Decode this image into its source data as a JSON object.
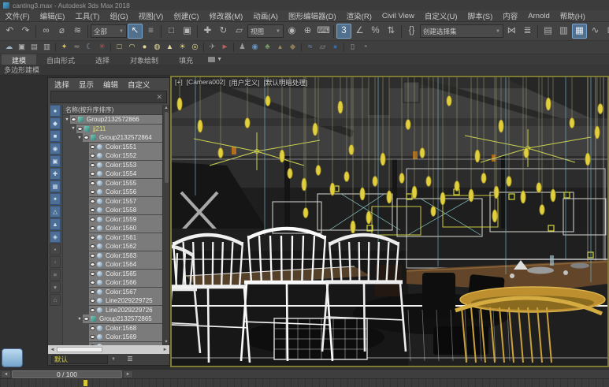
{
  "window": {
    "title": "canting3.max - Autodesk 3ds Max 2018"
  },
  "menu": {
    "items": [
      {
        "name": "menu-file",
        "label": "文件(F)"
      },
      {
        "name": "menu-edit",
        "label": "编辑(E)"
      },
      {
        "name": "menu-tools",
        "label": "工具(T)"
      },
      {
        "name": "menu-group",
        "label": "组(G)"
      },
      {
        "name": "menu-views",
        "label": "视图(V)"
      },
      {
        "name": "menu-create",
        "label": "创建(C)"
      },
      {
        "name": "menu-modifiers",
        "label": "修改器(M)"
      },
      {
        "name": "menu-animation",
        "label": "动画(A)"
      },
      {
        "name": "menu-graph-editors",
        "label": "图形编辑器(D)"
      },
      {
        "name": "menu-rendering",
        "label": "渲染(R)"
      },
      {
        "name": "menu-civil-view",
        "label": "Civil View"
      },
      {
        "name": "menu-customize",
        "label": "自定义(U)"
      },
      {
        "name": "menu-scripting",
        "label": "脚本(S)"
      },
      {
        "name": "menu-content",
        "label": "内容"
      },
      {
        "name": "menu-arnold",
        "label": "Arnold"
      },
      {
        "name": "menu-help",
        "label": "帮助(H)"
      }
    ]
  },
  "toolbar1": {
    "filter_value": "全部",
    "coord_value": "视图",
    "set_value": "创建选择集",
    "icons1": [
      {
        "name": "undo-icon",
        "glyph": "↶"
      },
      {
        "name": "redo-icon",
        "glyph": "↷"
      },
      {
        "sep": true
      },
      {
        "name": "select-and-link-icon",
        "glyph": "∞"
      },
      {
        "name": "unlink-selection-icon",
        "glyph": "⌀"
      },
      {
        "name": "bind-to-space-warp-icon",
        "glyph": "≋"
      },
      {
        "sep": true
      }
    ],
    "icons2": [
      {
        "name": "select-object-icon",
        "glyph": "↖",
        "active": true
      },
      {
        "name": "select-by-name-icon",
        "glyph": "≡"
      },
      {
        "sep": true
      },
      {
        "name": "rectangular-selection-region-icon",
        "glyph": "□"
      },
      {
        "name": "window-crossing-icon",
        "glyph": "▣"
      },
      {
        "sep": true
      },
      {
        "name": "select-and-move-icon",
        "glyph": "✚"
      },
      {
        "name": "select-and-rotate-icon",
        "glyph": "↻"
      },
      {
        "name": "select-and-scale-icon",
        "glyph": "▱"
      }
    ],
    "icons3": [
      {
        "name": "use-pivot-point-icon",
        "glyph": "◉"
      },
      {
        "name": "select-and-manipulate-icon",
        "glyph": "⊕"
      },
      {
        "name": "keyboard-shortcut-override-icon",
        "glyph": "⌨"
      },
      {
        "sep": true
      },
      {
        "name": "snaps-toggle-icon",
        "glyph": "3",
        "active": true
      },
      {
        "name": "angle-snap-icon",
        "glyph": "∠"
      },
      {
        "name": "percent-snap-icon",
        "glyph": "%"
      },
      {
        "name": "spinner-snap-icon",
        "glyph": "⇅"
      },
      {
        "sep": true
      },
      {
        "name": "edit-named-selection-sets-icon",
        "glyph": "{}"
      }
    ],
    "icons4": [
      {
        "name": "mirror-icon",
        "glyph": "⋈"
      },
      {
        "name": "align-icon",
        "glyph": "≣"
      },
      {
        "sep": true
      },
      {
        "name": "toggle-scene-explorer-icon",
        "glyph": "▤"
      },
      {
        "name": "toggle-layer-explorer-icon",
        "glyph": "▥"
      },
      {
        "name": "ribbon-toggle-icon",
        "glyph": "▦",
        "active": true
      },
      {
        "name": "curve-editor-icon",
        "glyph": "∿"
      },
      {
        "name": "schematic-view-icon",
        "glyph": "⊞"
      },
      {
        "name": "material-editor-icon",
        "glyph": "◎"
      }
    ]
  },
  "toolbar2": {
    "icons": [
      {
        "name": "render-presets-icon",
        "glyph": "☁",
        "color": "#9ab0c0"
      },
      {
        "name": "rendered-frame-window-icon",
        "glyph": "▣",
        "color": "#b0b0b0"
      },
      {
        "name": "render-setup-icon",
        "glyph": "▤",
        "color": "#b0b0b0"
      },
      {
        "name": "render-flyout-icon",
        "glyph": "▥",
        "color": "#b0b0b0"
      },
      {
        "sep": true
      },
      {
        "name": "populate-figure-icon",
        "glyph": "✦",
        "color": "#d8c25a"
      },
      {
        "name": "utilities-icon",
        "glyph": "≂",
        "color": "#9a9a9a"
      },
      {
        "name": "night-light-icon",
        "glyph": "☾",
        "color": "#8aa0b8"
      },
      {
        "name": "vray-swirl-icon",
        "glyph": "✳",
        "color": "#c05050"
      },
      {
        "sep": true
      },
      {
        "name": "quad-light-icon",
        "glyph": "□",
        "color": "#ded9a0"
      },
      {
        "name": "dome-light-icon",
        "glyph": "◠",
        "color": "#ded9a0"
      },
      {
        "name": "sphere-light-icon",
        "glyph": "●",
        "color": "#ded9a0"
      },
      {
        "name": "mesh-light-icon",
        "glyph": "◍",
        "color": "#ded9a0"
      },
      {
        "name": "cone-light-icon",
        "glyph": "▲",
        "color": "#ded9a0"
      },
      {
        "name": "sun-light-icon",
        "glyph": "☀",
        "color": "#e0d070"
      },
      {
        "name": "ring-light-icon",
        "glyph": "◎",
        "color": "#ded9a0"
      },
      {
        "sep": true
      },
      {
        "name": "camera-icon",
        "glyph": "✈",
        "color": "#9a9a9a"
      },
      {
        "name": "target-icon",
        "glyph": "►",
        "color": "#c06060"
      },
      {
        "sep": true
      },
      {
        "name": "figure-icon",
        "glyph": "♟",
        "color": "#9a9a9a"
      },
      {
        "name": "globe-icon",
        "glyph": "◉",
        "color": "#6a94c0"
      },
      {
        "name": "plant-icon",
        "glyph": "♣",
        "color": "#7aa060"
      },
      {
        "name": "terrain-icon",
        "glyph": "▴",
        "color": "#a08860"
      },
      {
        "name": "rock-icon",
        "glyph": "◆",
        "color": "#8a7a5a"
      },
      {
        "sep": true
      },
      {
        "name": "water-icon",
        "glyph": "≈",
        "color": "#6a94c0"
      },
      {
        "name": "doc-icon",
        "glyph": "▱",
        "color": "#9a9a9a"
      },
      {
        "name": "sphere-blue-icon",
        "glyph": "●",
        "color": "#3a6aa0"
      },
      {
        "sep": true
      },
      {
        "name": "container-icon",
        "glyph": "▯",
        "color": "#9a9a9a"
      },
      {
        "name": "help-icon",
        "glyph": "◔",
        "color": "#9a9a9a"
      }
    ]
  },
  "ribbon": {
    "tabs": [
      {
        "name": "tab-modeling",
        "label": "建模",
        "active": true
      },
      {
        "name": "tab-freeform",
        "label": "自由形式"
      },
      {
        "name": "tab-selection",
        "label": "选择"
      },
      {
        "name": "tab-object-paint",
        "label": "对象绘制"
      },
      {
        "name": "tab-populate",
        "label": "填充"
      }
    ],
    "panel_label": "多边形建模"
  },
  "explorer": {
    "menu": [
      {
        "name": "explorer-menu-select",
        "label": "选择"
      },
      {
        "name": "explorer-menu-display",
        "label": "显示"
      },
      {
        "name": "explorer-menu-edit",
        "label": "编辑"
      },
      {
        "name": "explorer-menu-customize",
        "label": "自定义"
      }
    ],
    "close_glyph": "✕",
    "header": "名称(按升序排序)",
    "footer_layer": "默认",
    "filters": [
      {
        "name": "display-all-toggle",
        "glyph": "●",
        "active": true
      },
      {
        "name": "display-geometry-toggle",
        "glyph": "◆",
        "active": true
      },
      {
        "name": "display-shapes-toggle",
        "glyph": "■",
        "active": true
      },
      {
        "name": "display-lights-toggle",
        "glyph": "◉",
        "active": true
      },
      {
        "name": "display-cameras-toggle",
        "glyph": "▣",
        "active": true
      },
      {
        "name": "display-helpers-toggle",
        "glyph": "✚",
        "active": true
      },
      {
        "name": "display-spacewarps-toggle",
        "glyph": "▦",
        "active": true
      },
      {
        "name": "display-particles-toggle",
        "glyph": "✦",
        "active": true
      },
      {
        "name": "display-bones-toggle",
        "glyph": "△",
        "active": true
      },
      {
        "name": "display-containers-toggle",
        "glyph": "▲",
        "active": true
      },
      {
        "name": "display-materials-toggle",
        "glyph": "◈",
        "active": true
      },
      {
        "name": "lock-navigation-toggle",
        "glyph": "▪",
        "active": false
      },
      {
        "name": "pick-parent-toggle",
        "glyph": "▫",
        "active": false
      },
      {
        "name": "select-children-toggle",
        "glyph": "≡",
        "active": false
      },
      {
        "name": "sort-filter-toggle",
        "glyph": "▾",
        "active": false
      },
      {
        "name": "folder-view-toggle",
        "glyph": "⌂",
        "active": false
      }
    ],
    "tree": [
      {
        "name": "tree-row-group2132572866",
        "label": "Group2132572866",
        "level": 0,
        "caret": "▼",
        "type": "group"
      },
      {
        "name": "tree-row-jj211",
        "label": "jj211",
        "level": 1,
        "caret": "▼",
        "type": "group",
        "color": "#ddd98a"
      },
      {
        "name": "tree-row-group2132572864",
        "label": "Group2132572864",
        "level": 2,
        "caret": "▼",
        "type": "group"
      },
      {
        "label": "Color:1551",
        "level": 3,
        "type": "object"
      },
      {
        "label": "Color:1552",
        "level": 3,
        "type": "object"
      },
      {
        "label": "Color:1553",
        "level": 3,
        "type": "object"
      },
      {
        "label": "Color:1554",
        "level": 3,
        "type": "object"
      },
      {
        "label": "Color:1555",
        "level": 3,
        "type": "object"
      },
      {
        "label": "Color:1556",
        "level": 3,
        "type": "object"
      },
      {
        "label": "Color:1557",
        "level": 3,
        "type": "object"
      },
      {
        "label": "Color:1558",
        "level": 3,
        "type": "object"
      },
      {
        "label": "Color:1559",
        "level": 3,
        "type": "object"
      },
      {
        "label": "Color:1560",
        "level": 3,
        "type": "object"
      },
      {
        "label": "Color:1561",
        "level": 3,
        "type": "object"
      },
      {
        "label": "Color:1562",
        "level": 3,
        "type": "object"
      },
      {
        "label": "Color:1563",
        "level": 3,
        "type": "object"
      },
      {
        "label": "Color:1564",
        "level": 3,
        "type": "object"
      },
      {
        "label": "Color:1565",
        "level": 3,
        "type": "object"
      },
      {
        "label": "Color:1566",
        "level": 3,
        "type": "object"
      },
      {
        "label": "Color:1567",
        "level": 3,
        "type": "object"
      },
      {
        "label": "Line2029229725",
        "level": 3,
        "type": "object"
      },
      {
        "label": "Line2029229726",
        "level": 3,
        "type": "object"
      },
      {
        "name": "tree-row-group2132572865",
        "label": "Group2132572865",
        "level": 2,
        "caret": "▼",
        "type": "group"
      },
      {
        "label": "Color:1568",
        "level": 3,
        "type": "object"
      },
      {
        "label": "Color:1569",
        "level": 3,
        "type": "object"
      },
      {
        "label": "",
        "level": 3,
        "type": "object"
      }
    ]
  },
  "viewport": {
    "label_plus": "[+]",
    "label_camera": "[Camera002]",
    "label_user": "[用户定义]",
    "label_shading": "[默认明暗处理]"
  },
  "timeline": {
    "frame_display": "0 / 100"
  },
  "colors": {
    "viewport_border": "#7c7c34",
    "selection_yellow": "#e2cf3d",
    "highlight_blue": "#51708e",
    "layer_text_yellow": "#d8d242"
  }
}
